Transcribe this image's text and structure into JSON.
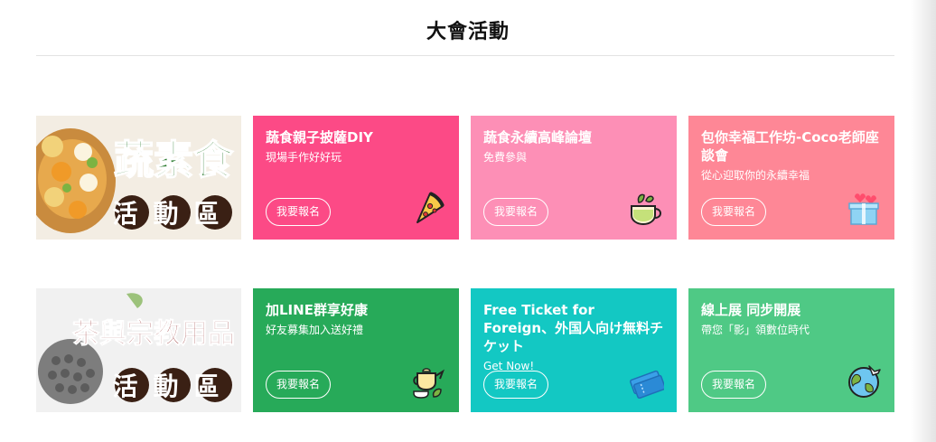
{
  "section": {
    "title": "大會活動"
  },
  "banners": [
    {
      "main": "蔬素食",
      "sub": "活動區"
    },
    {
      "main": "茶與宗教用品",
      "sub": "活動區"
    }
  ],
  "cards": [
    {
      "title": "蔬食親子披薩DIY",
      "subtitle": "現場手作好好玩",
      "button": "我要報名",
      "icon": "pizza-icon",
      "color": "#fc4a86"
    },
    {
      "title": "蔬食永續高峰論壇",
      "subtitle": "免費參與",
      "button": "我要報名",
      "icon": "tea-cup-icon",
      "color": "#fd8fb6"
    },
    {
      "title": "包你幸福工作坊-Coco老師座談會",
      "subtitle": "從心迎取你的永續幸福",
      "button": "我要報名",
      "icon": "gift-box-icon",
      "color": "#fe8796"
    },
    {
      "title": "加LINE群享好康",
      "subtitle": "好友募集加入送好禮",
      "button": "我要報名",
      "icon": "teapot-icon",
      "color": "#27aa59"
    },
    {
      "title": "Free Ticket for Foreign、外国人向け無料チケット",
      "subtitle": "Get Now!",
      "button": "我要報名",
      "icon": "ticket-icon",
      "color": "#13c8c3"
    },
    {
      "title": "線上展 同步開展",
      "subtitle": "帶您「影」領數位時代",
      "button": "我要報名",
      "icon": "globe-plane-icon",
      "color": "#4fc985"
    }
  ]
}
